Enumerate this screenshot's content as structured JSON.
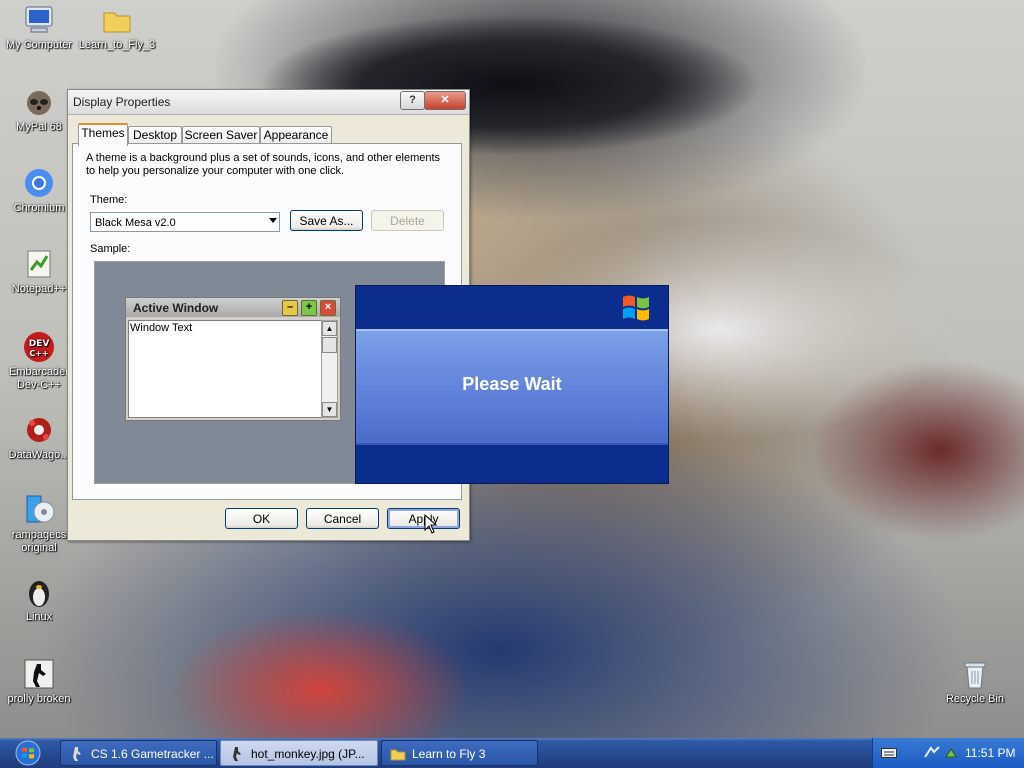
{
  "desktop": {
    "icons": [
      {
        "label": "My Computer",
        "icon": "computer-icon"
      },
      {
        "label": "Learn_to_Fly_3",
        "icon": "folder-icon"
      },
      {
        "label": "MyPal 68",
        "icon": "raccoon-app-icon"
      },
      {
        "label": "Chromium",
        "icon": "chromium-icon"
      },
      {
        "label": "Notepad++",
        "icon": "notepad-plus-icon"
      },
      {
        "label": "Embarcadero Dev-C++",
        "label_line1": "Embarcader",
        "label_line2": "Dev-C++",
        "icon": "devcpp-icon"
      },
      {
        "label": "DataWago...",
        "icon": "datawagon-icon"
      },
      {
        "label": "rampagecs original",
        "label_line1": "rampagecs",
        "label_line2": "original",
        "icon": "disc-icon"
      },
      {
        "label": "Linux",
        "icon": "tux-icon"
      },
      {
        "label": "prolly broken",
        "icon": "counter-strike-icon"
      },
      {
        "label": "Recycle Bin",
        "icon": "recycle-bin-icon"
      }
    ]
  },
  "dialog": {
    "title": "Display Properties",
    "help_btn": "?",
    "close_btn": "✕",
    "tabs": [
      "Themes",
      "Desktop",
      "Screen Saver",
      "Appearance"
    ],
    "active_tab": "Themes",
    "description": "A theme is a background plus a set of sounds, icons, and other elements to help you personalize your computer with one click.",
    "theme_label": "Theme:",
    "theme_value": "Black Mesa v2.0",
    "save_as": "Save As...",
    "delete": "Delete",
    "sample_label": "Sample:",
    "sample": {
      "active_window_title": "Active Window",
      "window_text": "Window Text"
    },
    "ok": "OK",
    "cancel": "Cancel",
    "apply": "Apply"
  },
  "please_wait": {
    "text": "Please Wait",
    "logo": "windows-flag-logo"
  },
  "taskbar": {
    "start": "start-orb",
    "buttons": [
      {
        "label": "CS 1.6 Gametracker ...",
        "icon": "counter-strike-icon",
        "active": false
      },
      {
        "label": "hot_monkey.jpg (JP...",
        "icon": "image-viewer-icon",
        "active": true
      },
      {
        "label": "Learn to Fly 3",
        "icon": "folder-icon",
        "active": false
      }
    ],
    "clock": "11:51 PM"
  },
  "colors": {
    "taskbar": "#25488f",
    "dialog_bg": "#ece9d8",
    "wait_blue": "#0a2d8e",
    "wait_band": "#6c8ee0"
  }
}
